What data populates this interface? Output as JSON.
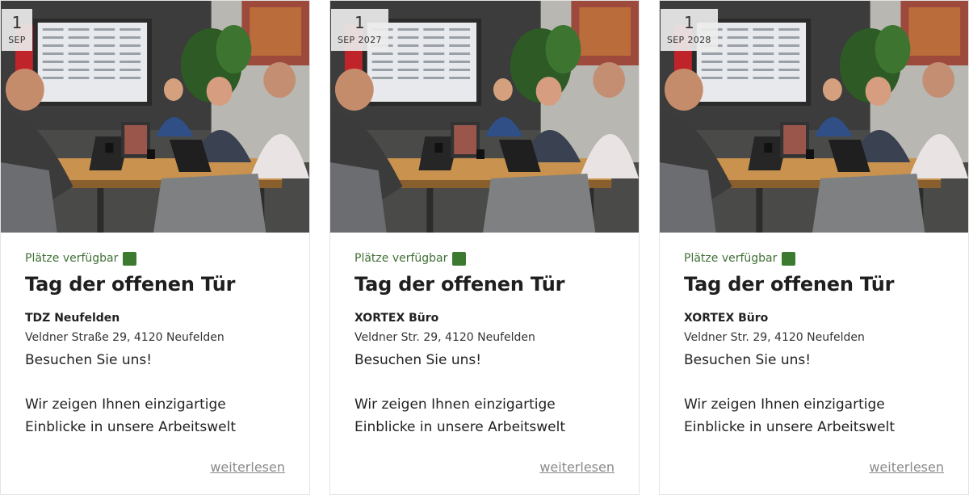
{
  "cards": [
    {
      "date": {
        "day": "1",
        "month": "SEP",
        "year": ""
      },
      "status_label": "Plätze verfügbar",
      "title": "Tag der offenen Tür",
      "venue": "TDZ Neufelden",
      "address": "Veldner Straße 29, 4120 Neufelden",
      "lead": "Besuchen Sie uns!",
      "description": "Wir zeigen Ihnen einzigartige Einblicke in unsere Arbeitswelt",
      "more_label": "weiterlesen"
    },
    {
      "date": {
        "day": "1",
        "month": "SEP",
        "year": "2027"
      },
      "status_label": "Plätze verfügbar",
      "title": "Tag der offenen Tür",
      "venue": "XORTEX Büro",
      "address": "Veldner Str. 29, 4120 Neufelden",
      "lead": "Besuchen Sie uns!",
      "description": "Wir zeigen Ihnen einzigartige Einblicke in unsere Arbeitswelt",
      "more_label": "weiterlesen"
    },
    {
      "date": {
        "day": "1",
        "month": "SEP",
        "year": "2028"
      },
      "status_label": "Plätze verfügbar",
      "title": "Tag der offenen Tür",
      "venue": "XORTEX Büro",
      "address": "Veldner Str. 29, 4120 Neufelden",
      "lead": "Besuchen Sie uns!",
      "description": "Wir zeigen Ihnen einzigartige Einblicke in unsere Arbeitswelt",
      "more_label": "weiterlesen"
    }
  ],
  "colors": {
    "status_text": "#3f6f35",
    "status_indicator": "#3c7a30",
    "link": "#8a8a8a"
  }
}
